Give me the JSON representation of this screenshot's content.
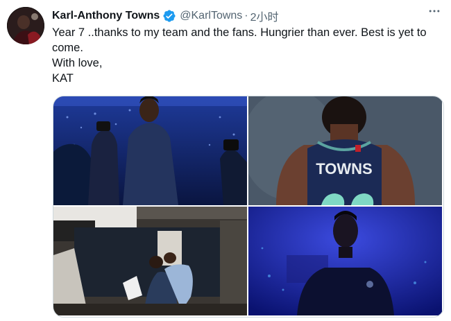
{
  "author": {
    "name": "Karl-Anthony Towns",
    "handle": "@KarlTowns",
    "separator": "·",
    "time": "2小时"
  },
  "icons": {
    "verified": "verified-badge-icon",
    "more": "more-options-icon"
  },
  "tweet": {
    "lines": [
      "Year 7 ..thanks to my team and the fans. Hungrier than ever. Best is yet to come.",
      "With love,",
      "KAT"
    ]
  },
  "media": {
    "photo2": {
      "jersey_name": "TOWNS"
    }
  },
  "colors": {
    "verified_blue": "#1d9bf0",
    "text_primary": "#0f1419",
    "text_secondary": "#536471",
    "border": "#cfd9de"
  }
}
